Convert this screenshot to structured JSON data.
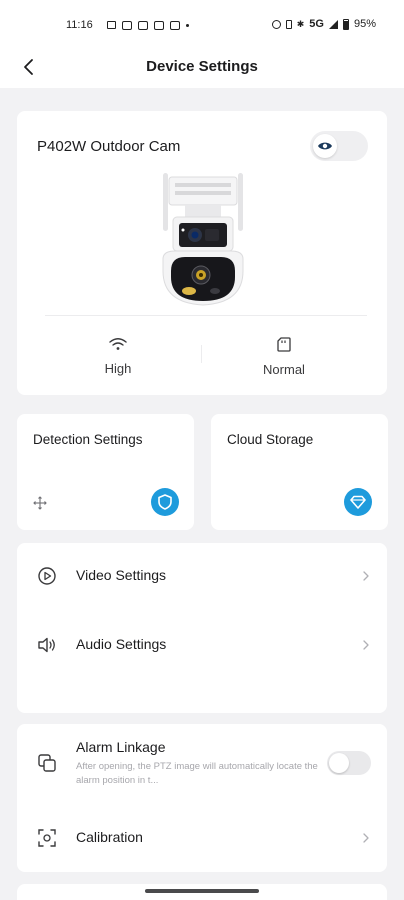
{
  "status_bar": {
    "time": "11:16",
    "network": "5G",
    "battery": "95%"
  },
  "header": {
    "title": "Device Settings",
    "back_icon": "chevron-left-icon"
  },
  "device": {
    "name": "P402W Outdoor Cam",
    "privacy_toggle_icon": "eye-icon",
    "privacy_toggle_on": false,
    "signal_label": "High",
    "signal_icon": "wifi-icon",
    "storage_label": "Normal",
    "storage_icon": "sd-card-icon"
  },
  "features": {
    "detection_title": "Detection Settings",
    "detection_icon": "shield-icon",
    "cloud_title": "Cloud Storage",
    "cloud_icon": "diamond-icon"
  },
  "settings": {
    "video_label": "Video Settings",
    "audio_label": "Audio Settings",
    "alarm_label": "Alarm Linkage",
    "alarm_desc": "After opening, the PTZ image will automatically locate the alarm position in t...",
    "alarm_on": false,
    "calibration_label": "Calibration"
  },
  "colors": {
    "accent": "#1e9bdc",
    "background": "#f2f2f4",
    "card": "#ffffff",
    "text_primary": "#1c1c1e",
    "text_secondary": "#a7a7ac"
  }
}
